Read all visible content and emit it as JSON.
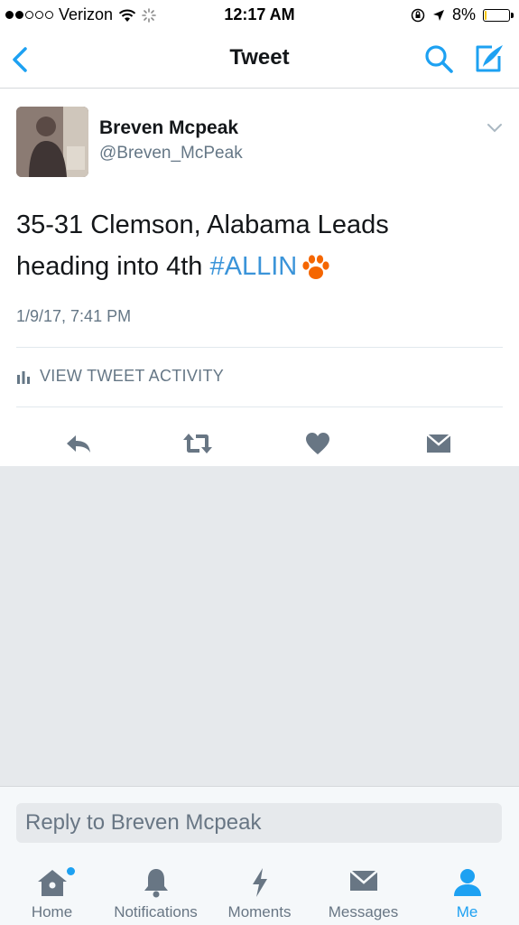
{
  "status_bar": {
    "carrier": "Verizon",
    "time": "12:17 AM",
    "battery_text": "8%",
    "battery_level": 0.08,
    "battery_color": "#f5c400"
  },
  "nav": {
    "title": "Tweet",
    "back_icon": "chevron-left-icon",
    "search_icon": "search-icon",
    "compose_icon": "compose-icon"
  },
  "tweet": {
    "author_name": "Breven Mcpeak",
    "author_handle": "@Breven_McPeak",
    "text_line1": "35-31 Clemson, Alabama Leads",
    "text_line2_prefix": "heading into 4th ",
    "hashtag": "#ALLIN",
    "emoji": "paw-print",
    "timestamp": "1/9/17, 7:41 PM",
    "activity_label": "VIEW TWEET ACTIVITY"
  },
  "reply": {
    "placeholder": "Reply to Breven Mcpeak"
  },
  "tabs": [
    {
      "label": "Home",
      "icon": "home-icon",
      "has_new": true
    },
    {
      "label": "Notifications",
      "icon": "bell-icon"
    },
    {
      "label": "Moments",
      "icon": "lightning-icon"
    },
    {
      "label": "Messages",
      "icon": "envelope-icon"
    },
    {
      "label": "Me",
      "icon": "person-icon",
      "active": true
    }
  ],
  "colors": {
    "accent": "#1da1f2",
    "hashtag": "#3b94d9",
    "icon_gray": "#687684",
    "paw": "#f56600"
  }
}
